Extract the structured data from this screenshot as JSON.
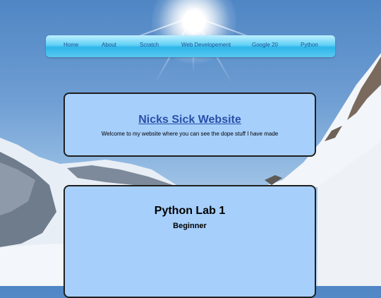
{
  "nav": {
    "items": [
      {
        "label": "Home"
      },
      {
        "label": "About"
      },
      {
        "label": "Scratch"
      },
      {
        "label": "Web Developement"
      },
      {
        "label": "Google 20"
      },
      {
        "label": "Python"
      }
    ]
  },
  "header": {
    "title": "Nicks Sick Website",
    "subtitle": "Welcome to my website where you can see the dope stuff I have made"
  },
  "content": {
    "title": "Python Lab 1",
    "subtitle": "Beginner"
  }
}
